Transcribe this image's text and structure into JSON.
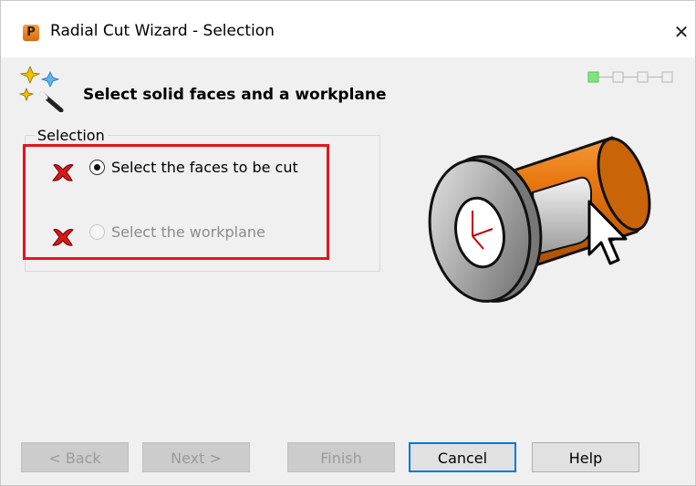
{
  "window": {
    "title": "Radial Cut Wizard - Selection",
    "app_icon_letter": "P",
    "close_glyph": "✕"
  },
  "header": {
    "title": "Select solid faces and a workplane",
    "wizard_icon": "magic-wand-icon",
    "steps": {
      "total": 4,
      "current": 1,
      "active_color": "#7ee67e"
    }
  },
  "selection": {
    "legend": "Selection",
    "highlight_color": "#e8131b",
    "options": [
      {
        "label": "Select the faces to be cut",
        "checked": true,
        "enabled": true,
        "status_icon": "red-x-icon"
      },
      {
        "label": "Select the workplane",
        "checked": false,
        "enabled": false,
        "status_icon": "red-x-icon"
      }
    ]
  },
  "illustration": {
    "name": "cylindrical-part-illustration",
    "part_color": "#e8760e",
    "flange_color": "#a9a9a9"
  },
  "buttons": {
    "back": {
      "label": "< Back",
      "enabled": false
    },
    "next": {
      "label": "Next >",
      "enabled": false
    },
    "finish": {
      "label": "Finish",
      "enabled": false
    },
    "cancel": {
      "label": "Cancel",
      "enabled": true,
      "default": true
    },
    "help": {
      "label": "Help",
      "enabled": true
    }
  }
}
